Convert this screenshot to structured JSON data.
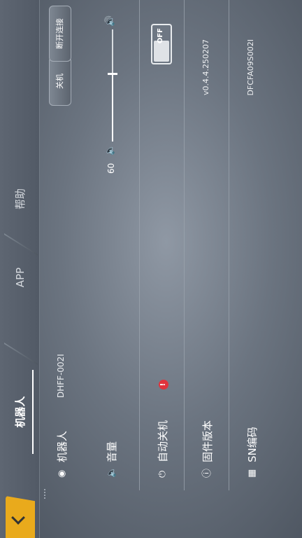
{
  "header": {
    "tabs": [
      {
        "label": "机器人",
        "active": true
      },
      {
        "label": "APP",
        "active": false
      },
      {
        "label": "帮助",
        "active": false
      }
    ]
  },
  "rows": {
    "robot": {
      "icon": "robot-icon",
      "label": "机器人",
      "value": "DHFF-002I",
      "disconnect_label": "断开连接",
      "shutdown_label": "关机"
    },
    "volume": {
      "icon": "speaker-icon",
      "label": "音量",
      "value_text": "60",
      "level": 0.6
    },
    "auto_off": {
      "icon": "power-icon",
      "label": "自动关机",
      "badge": "!",
      "toggle_label": "OFF",
      "toggle_on": false
    },
    "firmware": {
      "icon": "info-icon",
      "label": "固件版本",
      "value": "v0.4.4.250207"
    },
    "sn": {
      "icon": "barcode-icon",
      "label": "SN编码",
      "value": "DFCFA09S002I"
    }
  },
  "colors": {
    "accent": "#e9aa1c",
    "badge": "#e0343d"
  }
}
